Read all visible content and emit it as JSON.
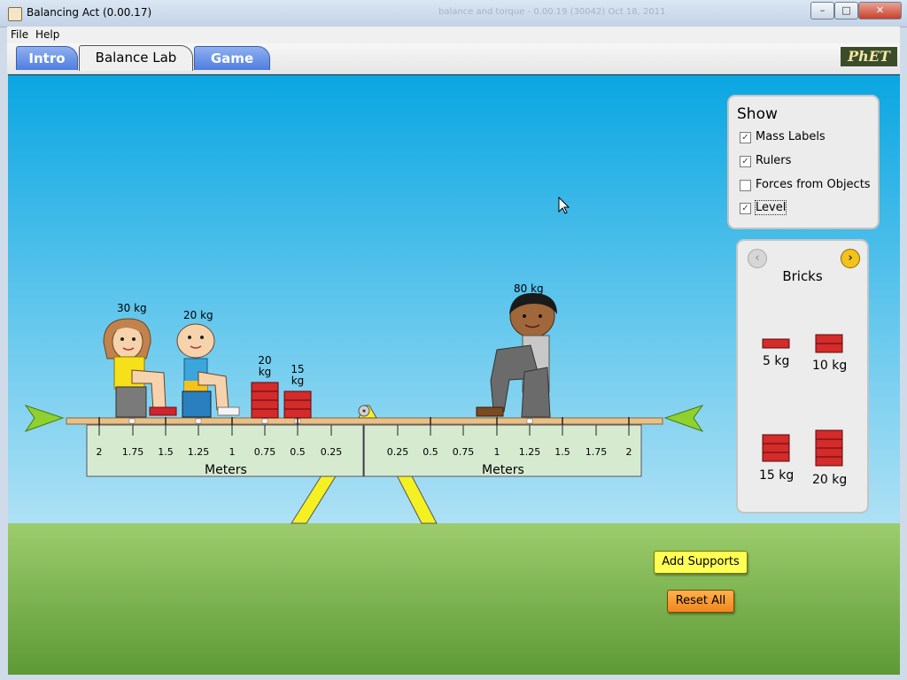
{
  "window": {
    "title": "Balancing Act (0.00.17)",
    "ghost_title": "balance and torque - 0.00.19 (30042) Oct 18, 2011",
    "min": "–",
    "max": "□",
    "close": "✕"
  },
  "menu": {
    "file": "File",
    "help": "Help"
  },
  "tabs": [
    {
      "label": "Intro"
    },
    {
      "label": "Balance Lab",
      "active": true
    },
    {
      "label": "Game"
    }
  ],
  "logo": "PhET",
  "show_panel": {
    "title": "Show",
    "items": [
      {
        "label": "Mass Labels",
        "checked": true
      },
      {
        "label": "Rulers",
        "checked": true
      },
      {
        "label": "Forces from Objects",
        "checked": false
      },
      {
        "label": "Level",
        "checked": true
      }
    ]
  },
  "bricks_panel": {
    "title": "Bricks",
    "prev_icon": "‹",
    "next_icon": "›",
    "items": [
      {
        "label": "5 kg",
        "count": 1
      },
      {
        "label": "10 kg",
        "count": 2
      },
      {
        "label": "15 kg",
        "count": 3
      },
      {
        "label": "20 kg",
        "count": 4
      }
    ]
  },
  "buttons": {
    "add_supports": "Add Supports",
    "reset_all": "Reset All"
  },
  "scene": {
    "masses": [
      {
        "label": "30 kg",
        "object": "girl"
      },
      {
        "label": "20 kg",
        "object": "boy"
      },
      {
        "label": "20 kg",
        "object": "brick-stack"
      },
      {
        "label": "15 kg",
        "object": "brick-stack"
      },
      {
        "label": "80 kg",
        "object": "man"
      }
    ],
    "ruler": {
      "left_ticks": [
        "2",
        "1.75",
        "1.5",
        "1.25",
        "1",
        "0.75",
        "0.5",
        "0.25"
      ],
      "right_ticks": [
        "0.25",
        "0.5",
        "0.75",
        "1",
        "1.25",
        "1.5",
        "1.75",
        "2"
      ],
      "unit_label": "Meters"
    },
    "colors": {
      "sky_top": "#0aa6e2",
      "ground": "#7ab64b",
      "plank": "#e8c089",
      "brick": "#d42b2b",
      "support": "#f5f022",
      "level_indicator": "#8fd12f"
    }
  }
}
